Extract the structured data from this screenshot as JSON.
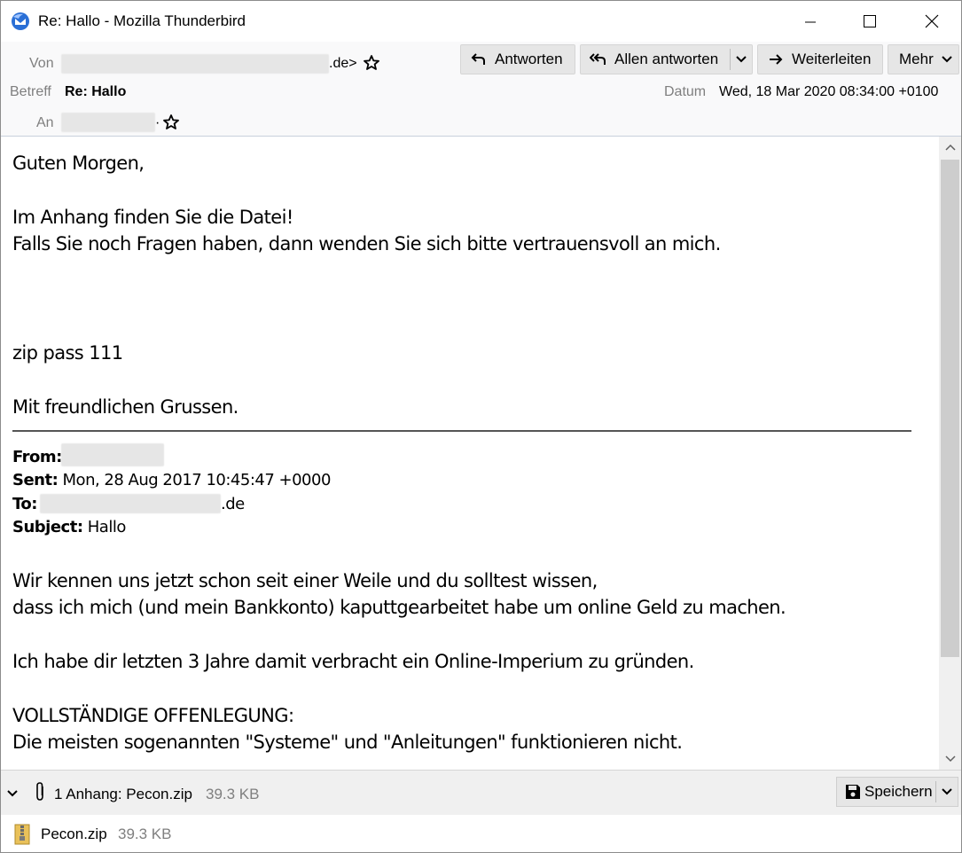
{
  "window": {
    "title": "Re: Hallo - Mozilla Thunderbird"
  },
  "header": {
    "from_label": "Von",
    "from_suffix": ".de>",
    "subject_label": "Betreff",
    "subject": "Re: Hallo",
    "date_label": "Datum",
    "date": "Wed, 18 Mar 2020 08:34:00 +0100",
    "to_label": "An",
    "to_suffix": "·"
  },
  "toolbar": {
    "reply": "Antworten",
    "reply_all": "Allen antworten",
    "forward": "Weiterleiten",
    "more": "Mehr"
  },
  "body": {
    "greeting": "Guten Morgen,",
    "line1": "Im Anhang finden Sie die Datei!",
    "line2": "Falls Sie noch Fragen haben, dann wenden Sie sich bitte vertrauensvoll an mich.",
    "zip": "zip pass 111",
    "closing": "Mit freundlichen Grussen.",
    "quoted": {
      "from_label": "From:",
      "sent_label": "Sent:",
      "sent": "Mon, 28 Aug 2017 10:45:47 +0000",
      "to_label": "To:",
      "to_suffix": ".de",
      "subject_label": "Subject:",
      "subject": "Hallo"
    },
    "q1": "Wir kennen uns jetzt schon seit einer Weile und du solltest wissen,",
    "q2": "dass ich mich (und mein Bankkonto) kaputtgearbeitet habe um online Geld zu machen.",
    "q3": "Ich habe dir letzten 3 Jahre damit verbracht ein Online-Imperium zu gründen.",
    "q4": "VOLLSTÄNDIGE OFFENLEGUNG:",
    "q5": "Die meisten sogenannten \"Systeme\" und \"Anleitungen\" funktionieren nicht."
  },
  "attachments": {
    "summary": "1 Anhang: Pecon.zip",
    "summary_size": "39.3 KB",
    "save": "Speichern",
    "items": [
      {
        "name": "Pecon.zip",
        "size": "39.3 KB"
      }
    ]
  }
}
